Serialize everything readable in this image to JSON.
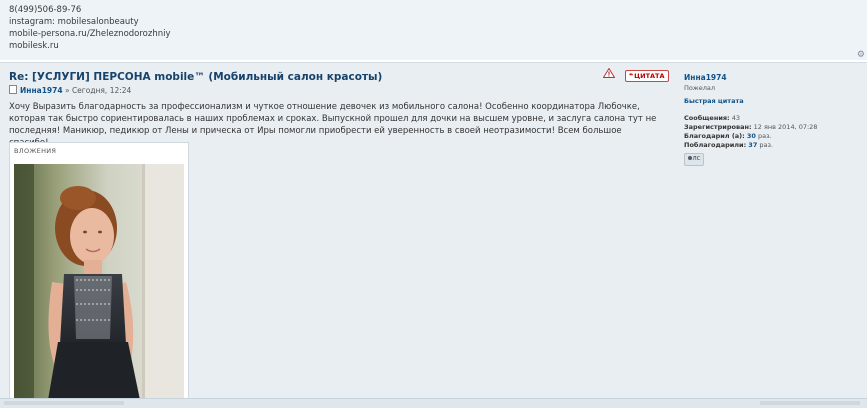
{
  "signature": {
    "lines": [
      "8(499)506-89-76",
      "instagram: mobilesalonbeauty",
      "mobile-persona.ru/Zheleznodorozhniy",
      "mobilesk.ru"
    ]
  },
  "post": {
    "title": "Re: [УСЛУГИ] ПЕРСОНА mobile™ (Мобильный салон красоты)",
    "author": "Инна1974",
    "date": "» Сегодня, 12:24",
    "quote_label": "ЦИТАТА",
    "body": "Хочу Выразить благодарность за профессионализм и чуткое отношение девочек из мобильного салона! Особенно координатора Любочке, которая так быстро сориентировалась в наших проблемах и сроках. Выпускной прошел для дочки на высшем уровне, и заслуга салона тут не последняя! Маникюр, педикюр от Лены и прическа от Иры помогли приобрести ей уверенность в своей неотразимости! Всем большое спасибо!",
    "attachments_label": "ВЛОЖЕНИЯ"
  },
  "profile": {
    "name": "Инна1974",
    "rank": "Пожелал",
    "quick_quote": "Быстрая цитата",
    "messages_label": "Сообщения:",
    "messages_value": "43",
    "registered_label": "Зарегистрирован:",
    "registered_value": "12 янв 2014, 07:28",
    "thanked_label": "Благодарил (а):",
    "thanked_value": "30",
    "thanked_unit": "раз.",
    "got_thanks_label": "Поблагодарили:",
    "got_thanks_value": "37",
    "got_thanks_unit": "раз.",
    "pm_label": "ЛС"
  },
  "colors": {
    "link": "#105289",
    "title": "#17436b",
    "post_bg": "#e9eef3",
    "quote_red": "#b30000"
  }
}
